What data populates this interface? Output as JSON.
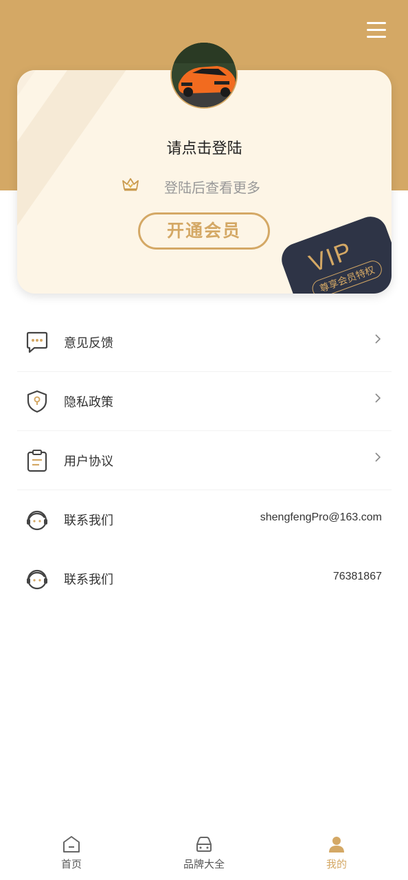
{
  "header": {
    "menu_icon": "menu-icon"
  },
  "profile": {
    "avatar_icon": "car-avatar",
    "login_prompt": "请点击登陆",
    "subtitle": "登陆后查看更多",
    "crown_icon": "crown-icon",
    "vip_button": "开通会员",
    "badge_title": "VIP",
    "badge_tag": "尊享会员特权"
  },
  "menu": {
    "items": [
      {
        "label": "意见反馈",
        "icon": "feedback-icon",
        "chevron": true
      },
      {
        "label": "隐私政策",
        "icon": "privacy-shield-icon",
        "chevron": true
      },
      {
        "label": "用户协议",
        "icon": "clipboard-icon",
        "chevron": true
      },
      {
        "label": "联系我们",
        "icon": "customer-service-icon",
        "value": "shengfengPro@163.com"
      },
      {
        "label": "联系我们",
        "icon": "customer-service-icon",
        "value": "76381867"
      }
    ]
  },
  "tabbar": {
    "tabs": [
      {
        "label": "首页",
        "icon": "home-icon",
        "active": false
      },
      {
        "label": "品牌大全",
        "icon": "car-icon",
        "active": false
      },
      {
        "label": "我的",
        "icon": "user-icon",
        "active": true
      }
    ]
  },
  "colors": {
    "accent": "#d4a865",
    "badge_bg": "#2e3446",
    "card_bg": "#fdf5e6"
  }
}
